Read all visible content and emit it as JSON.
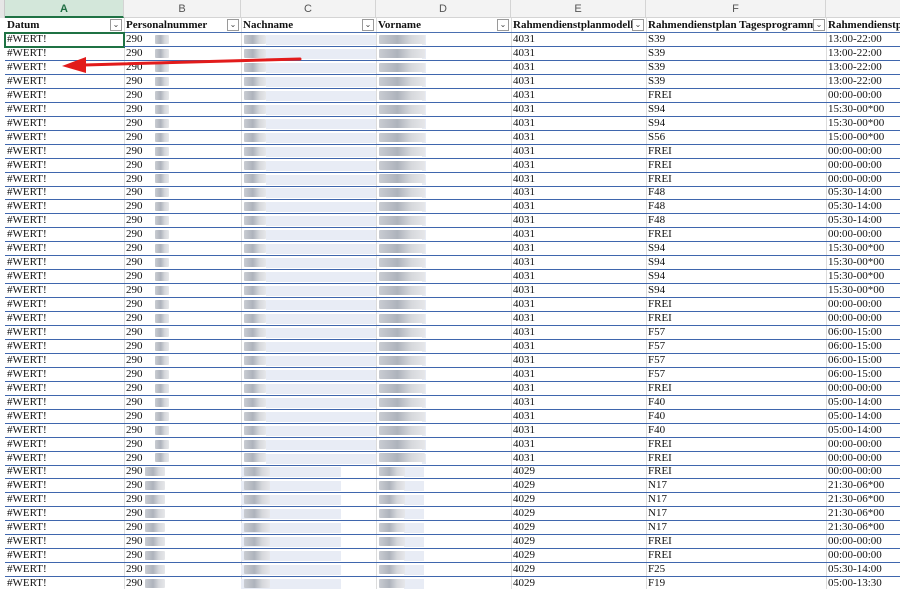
{
  "columns": {
    "letters": [
      "A",
      "B",
      "C",
      "D",
      "E",
      "F"
    ],
    "headers": [
      "Datum",
      "Personalnummer",
      "Nachname",
      "Vorname",
      "Rahmendienstplanmodell",
      "Rahmendienstplan Tagesprogramm",
      "Rahmendienstpl"
    ]
  },
  "active_column": "A",
  "selected_cell": "A2",
  "rows": [
    {
      "datum": "#WERT!",
      "pnr": "290",
      "modell": "4031",
      "tagesprogramm": "S39",
      "zeit": "13:00-22:00"
    },
    {
      "datum": "#WERT!",
      "pnr": "290",
      "modell": "4031",
      "tagesprogramm": "S39",
      "zeit": "13:00-22:00"
    },
    {
      "datum": "#WERT!",
      "pnr": "290",
      "modell": "4031",
      "tagesprogramm": "S39",
      "zeit": "13:00-22:00"
    },
    {
      "datum": "#WERT!",
      "pnr": "290",
      "modell": "4031",
      "tagesprogramm": "S39",
      "zeit": "13:00-22:00"
    },
    {
      "datum": "#WERT!",
      "pnr": "290",
      "modell": "4031",
      "tagesprogramm": "FREI",
      "zeit": "00:00-00:00"
    },
    {
      "datum": "#WERT!",
      "pnr": "290",
      "modell": "4031",
      "tagesprogramm": "S94",
      "zeit": "15:30-00*00"
    },
    {
      "datum": "#WERT!",
      "pnr": "290",
      "modell": "4031",
      "tagesprogramm": "S94",
      "zeit": "15:30-00*00"
    },
    {
      "datum": "#WERT!",
      "pnr": "290",
      "modell": "4031",
      "tagesprogramm": "S56",
      "zeit": "15:00-00*00"
    },
    {
      "datum": "#WERT!",
      "pnr": "290",
      "modell": "4031",
      "tagesprogramm": "FREI",
      "zeit": "00:00-00:00"
    },
    {
      "datum": "#WERT!",
      "pnr": "290",
      "modell": "4031",
      "tagesprogramm": "FREI",
      "zeit": "00:00-00:00"
    },
    {
      "datum": "#WERT!",
      "pnr": "290",
      "modell": "4031",
      "tagesprogramm": "FREI",
      "zeit": "00:00-00:00"
    },
    {
      "datum": "#WERT!",
      "pnr": "290",
      "modell": "4031",
      "tagesprogramm": "F48",
      "zeit": "05:30-14:00"
    },
    {
      "datum": "#WERT!",
      "pnr": "290",
      "modell": "4031",
      "tagesprogramm": "F48",
      "zeit": "05:30-14:00"
    },
    {
      "datum": "#WERT!",
      "pnr": "290",
      "modell": "4031",
      "tagesprogramm": "F48",
      "zeit": "05:30-14:00"
    },
    {
      "datum": "#WERT!",
      "pnr": "290",
      "modell": "4031",
      "tagesprogramm": "FREI",
      "zeit": "00:00-00:00"
    },
    {
      "datum": "#WERT!",
      "pnr": "290",
      "modell": "4031",
      "tagesprogramm": "S94",
      "zeit": "15:30-00*00"
    },
    {
      "datum": "#WERT!",
      "pnr": "290",
      "modell": "4031",
      "tagesprogramm": "S94",
      "zeit": "15:30-00*00"
    },
    {
      "datum": "#WERT!",
      "pnr": "290",
      "modell": "4031",
      "tagesprogramm": "S94",
      "zeit": "15:30-00*00"
    },
    {
      "datum": "#WERT!",
      "pnr": "290",
      "modell": "4031",
      "tagesprogramm": "S94",
      "zeit": "15:30-00*00"
    },
    {
      "datum": "#WERT!",
      "pnr": "290",
      "modell": "4031",
      "tagesprogramm": "FREI",
      "zeit": "00:00-00:00"
    },
    {
      "datum": "#WERT!",
      "pnr": "290",
      "modell": "4031",
      "tagesprogramm": "FREI",
      "zeit": "00:00-00:00"
    },
    {
      "datum": "#WERT!",
      "pnr": "290",
      "modell": "4031",
      "tagesprogramm": "F57",
      "zeit": "06:00-15:00"
    },
    {
      "datum": "#WERT!",
      "pnr": "290",
      "modell": "4031",
      "tagesprogramm": "F57",
      "zeit": "06:00-15:00"
    },
    {
      "datum": "#WERT!",
      "pnr": "290",
      "modell": "4031",
      "tagesprogramm": "F57",
      "zeit": "06:00-15:00"
    },
    {
      "datum": "#WERT!",
      "pnr": "290",
      "modell": "4031",
      "tagesprogramm": "F57",
      "zeit": "06:00-15:00"
    },
    {
      "datum": "#WERT!",
      "pnr": "290",
      "modell": "4031",
      "tagesprogramm": "FREI",
      "zeit": "00:00-00:00"
    },
    {
      "datum": "#WERT!",
      "pnr": "290",
      "modell": "4031",
      "tagesprogramm": "F40",
      "zeit": "05:00-14:00"
    },
    {
      "datum": "#WERT!",
      "pnr": "290",
      "modell": "4031",
      "tagesprogramm": "F40",
      "zeit": "05:00-14:00"
    },
    {
      "datum": "#WERT!",
      "pnr": "290",
      "modell": "4031",
      "tagesprogramm": "F40",
      "zeit": "05:00-14:00"
    },
    {
      "datum": "#WERT!",
      "pnr": "290",
      "modell": "4031",
      "tagesprogramm": "FREI",
      "zeit": "00:00-00:00"
    },
    {
      "datum": "#WERT!",
      "pnr": "290",
      "modell": "4031",
      "tagesprogramm": "FREI",
      "zeit": "00:00-00:00"
    },
    {
      "datum": "#WERT!",
      "pnr": "290",
      "modell": "4029",
      "tagesprogramm": "FREI",
      "zeit": "00:00-00:00"
    },
    {
      "datum": "#WERT!",
      "pnr": "290",
      "modell": "4029",
      "tagesprogramm": "N17",
      "zeit": "21:30-06*00"
    },
    {
      "datum": "#WERT!",
      "pnr": "290",
      "modell": "4029",
      "tagesprogramm": "N17",
      "zeit": "21:30-06*00"
    },
    {
      "datum": "#WERT!",
      "pnr": "290",
      "modell": "4029",
      "tagesprogramm": "N17",
      "zeit": "21:30-06*00"
    },
    {
      "datum": "#WERT!",
      "pnr": "290",
      "modell": "4029",
      "tagesprogramm": "N17",
      "zeit": "21:30-06*00"
    },
    {
      "datum": "#WERT!",
      "pnr": "290",
      "modell": "4029",
      "tagesprogramm": "FREI",
      "zeit": "00:00-00:00"
    },
    {
      "datum": "#WERT!",
      "pnr": "290",
      "modell": "4029",
      "tagesprogramm": "FREI",
      "zeit": "00:00-00:00"
    },
    {
      "datum": "#WERT!",
      "pnr": "290",
      "modell": "4029",
      "tagesprogramm": "F25",
      "zeit": "05:30-14:00"
    },
    {
      "datum": "#WERT!",
      "pnr": "290",
      "modell": "4029",
      "tagesprogramm": "F19",
      "zeit": "05:00-13:30"
    }
  ],
  "colors": {
    "accent": "#1f7244",
    "row_border": "#3f66ad",
    "arrow": "#e21b1b"
  },
  "icons": {
    "filter": "filter-dropdown-icon",
    "annotation": "red-arrow"
  }
}
